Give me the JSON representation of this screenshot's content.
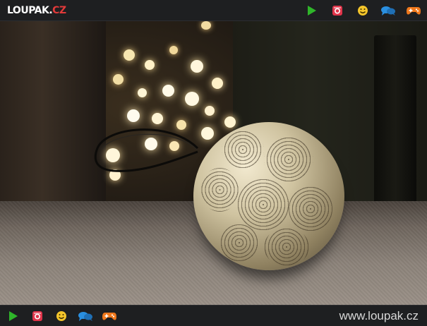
{
  "header": {
    "logo_main": "LOUPAK.",
    "logo_tld": "CZ"
  },
  "icons": {
    "play": "play-icon",
    "instagram": "instagram-icon",
    "smiley": "smiley-icon",
    "chat": "chat-icon",
    "gamepad": "gamepad-icon"
  },
  "colors": {
    "play": "#2fb52a",
    "instagram": "#e0344a",
    "smiley": "#f4c52b",
    "chat": "#2a8fe0",
    "gamepad": "#f0781c",
    "logo_tld": "#e23a3a"
  },
  "footer": {
    "site_url": "www.loupak.cz"
  }
}
